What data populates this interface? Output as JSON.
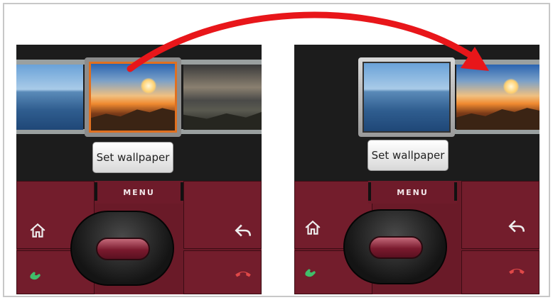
{
  "left_phone": {
    "gallery": {
      "thumbnails": [
        "lake-landscape",
        "sunset-landscape",
        "coast-landscape"
      ],
      "selected": "sunset-landscape"
    },
    "set_wallpaper_label": "Set wallpaper",
    "keypad": {
      "menu_label": "MENU",
      "icons": [
        "home-icon",
        "back-icon",
        "call-icon",
        "end-call-icon"
      ]
    }
  },
  "right_phone": {
    "gallery": {
      "thumbnails": [
        "lake-landscape",
        "sunset-landscape"
      ],
      "selected": "lake-landscape"
    },
    "set_wallpaper_label": "Set wallpaper",
    "keypad": {
      "menu_label": "MENU",
      "icons": [
        "home-icon",
        "back-icon",
        "call-icon",
        "end-call-icon"
      ]
    }
  },
  "colors": {
    "arrow": "#e8161a",
    "keypad": "#6a1a28",
    "selection_border": "#e07020"
  }
}
